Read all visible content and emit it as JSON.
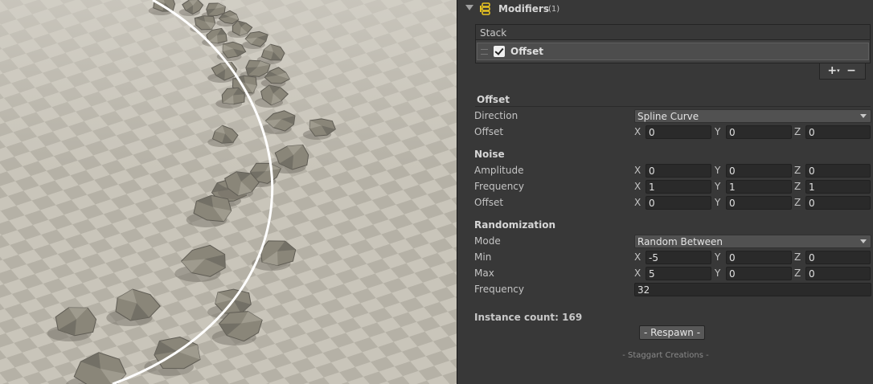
{
  "component": {
    "title": "Modifiers",
    "count": "(1)",
    "icon": "modifiers-stack-icon"
  },
  "stack": {
    "header": "Stack",
    "items": [
      {
        "label": "Offset",
        "enabled": true
      }
    ],
    "add_label": "+",
    "add_suffix": "▾",
    "remove_label": "−"
  },
  "offset_section": {
    "title": "Offset",
    "direction": {
      "label": "Direction",
      "value": "Spline Curve"
    },
    "offset": {
      "label": "Offset",
      "x": "0",
      "y": "0",
      "z": "0"
    }
  },
  "noise": {
    "title": "Noise",
    "amplitude": {
      "label": "Amplitude",
      "x": "0",
      "y": "0",
      "z": "0"
    },
    "frequency": {
      "label": "Frequency",
      "x": "1",
      "y": "1",
      "z": "1"
    },
    "offset": {
      "label": "Offset",
      "x": "0",
      "y": "0",
      "z": "0"
    }
  },
  "randomization": {
    "title": "Randomization",
    "mode": {
      "label": "Mode",
      "value": "Random Between"
    },
    "min": {
      "label": "Min",
      "x": "-5",
      "y": "0",
      "z": "0"
    },
    "max": {
      "label": "Max",
      "x": "5",
      "y": "0",
      "z": "0"
    },
    "frequency": {
      "label": "Frequency",
      "value": "32"
    }
  },
  "axis_labels": {
    "x": "X",
    "y": "Y",
    "z": "Z"
  },
  "instance_count": "Instance count: 169",
  "respawn_label": "- Respawn -",
  "footer": "- Staggart Creations -",
  "colors": {
    "panel_bg": "#383838",
    "field_bg": "#2a2a2a",
    "rock": "#8a8679",
    "checker_light": "#c9c5ba",
    "checker_dark": "#b3afa4",
    "spline": "#ffffff",
    "icon_yellow": "#e8c420"
  }
}
